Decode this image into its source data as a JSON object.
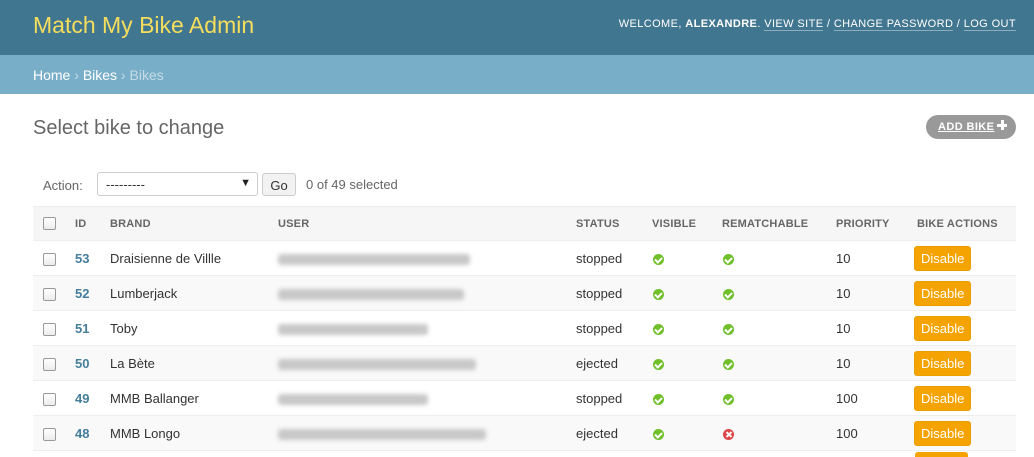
{
  "header": {
    "site_title": "Match My Bike Admin",
    "welcome": "Welcome, ",
    "username": "alexandre",
    "period": ". ",
    "view_site": "View site",
    "sep": " / ",
    "change_password": "Change password",
    "log_out": "Log out"
  },
  "breadcrumbs": {
    "home": "Home",
    "sep": " › ",
    "app": "Bikes",
    "current": "Bikes"
  },
  "page": {
    "title": "Select bike to change",
    "add_button": "Add bike"
  },
  "actions": {
    "label": "Action:",
    "selected_option": "---------",
    "go_label": "Go",
    "counter": "0 of 49 selected"
  },
  "table": {
    "columns": [
      "ID",
      "Brand",
      "User",
      "Status",
      "Visible",
      "Rematchable",
      "Priority",
      "Bike actions"
    ],
    "rows": [
      {
        "id": "53",
        "brand": "Draisienne de Villle",
        "status": "stopped",
        "visible": true,
        "rematchable": true,
        "priority": "10",
        "action": "Disable"
      },
      {
        "id": "52",
        "brand": "Lumberjack",
        "status": "stopped",
        "visible": true,
        "rematchable": true,
        "priority": "10",
        "action": "Disable"
      },
      {
        "id": "51",
        "brand": "Toby",
        "status": "stopped",
        "visible": true,
        "rematchable": true,
        "priority": "10",
        "action": "Disable"
      },
      {
        "id": "50",
        "brand": "La Bète",
        "status": "ejected",
        "visible": true,
        "rematchable": true,
        "priority": "10",
        "action": "Disable"
      },
      {
        "id": "49",
        "brand": "MMB Ballanger",
        "status": "stopped",
        "visible": true,
        "rematchable": true,
        "priority": "100",
        "action": "Disable"
      },
      {
        "id": "48",
        "brand": "MMB Longo",
        "status": "ejected",
        "visible": true,
        "rematchable": false,
        "priority": "100",
        "action": "Disable"
      }
    ]
  },
  "colors": {
    "header_bg": "#417690",
    "brand_yellow": "#f5dd5d",
    "breadcrumb_bg": "#79aec8",
    "link": "#447e9b",
    "button_orange": "#f5a300",
    "icon_yes": "#70bf2b",
    "icon_no": "#dd4646"
  }
}
